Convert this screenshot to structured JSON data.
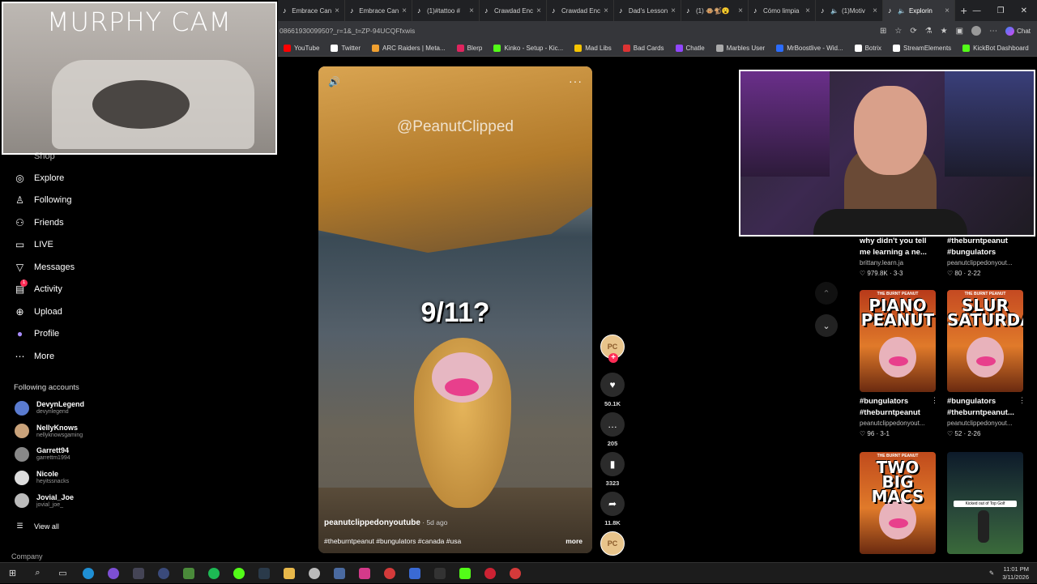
{
  "browser": {
    "tabs": [
      {
        "label": "Embrace Can"
      },
      {
        "label": "Embrace Can"
      },
      {
        "label": "(1)#tattoo #"
      },
      {
        "label": "Crawdad Enc"
      },
      {
        "label": "Crawdad Enc"
      },
      {
        "label": "Dad's Lesson"
      },
      {
        "label": "(1) 🐵🐒😮"
      },
      {
        "label": "Cómo limpia"
      },
      {
        "label": "(1)Motiv"
      },
      {
        "label": "Explorin"
      }
    ],
    "url": "0866193009950?_r=1&_t=ZP-94UCQFfxwis",
    "chat_label": "Chat",
    "bookmarks": [
      {
        "label": "YouTube",
        "color": "#ff0000"
      },
      {
        "label": "Twitter",
        "color": "#ffffff"
      },
      {
        "label": "ARC Raiders | Meta...",
        "color": "#f0a030"
      },
      {
        "label": "Blerp",
        "color": "#e0245e"
      },
      {
        "label": "Kinko - Setup - Kic...",
        "color": "#53fc18"
      },
      {
        "label": "Mad Libs",
        "color": "#f5c400"
      },
      {
        "label": "Bad Cards",
        "color": "#d33"
      },
      {
        "label": "Chatle",
        "color": "#9146ff"
      },
      {
        "label": "Marbles User",
        "color": "#aaaaaa"
      },
      {
        "label": "MrBoostlive - Wid...",
        "color": "#2b6cff"
      },
      {
        "label": "Botrix",
        "color": "#ffffff"
      },
      {
        "label": "StreamElements",
        "color": "#ffffff"
      },
      {
        "label": "KickBot Dashboard",
        "color": "#53fc18"
      }
    ]
  },
  "overlay": {
    "murphy_title": "MURPHY CAM"
  },
  "sidebar": {
    "shop_label": "Shop",
    "items": [
      {
        "label": "Explore",
        "icon": "compass-icon"
      },
      {
        "label": "Following",
        "icon": "following-icon"
      },
      {
        "label": "Friends",
        "icon": "friends-icon"
      },
      {
        "label": "LIVE",
        "icon": "live-icon"
      },
      {
        "label": "Messages",
        "icon": "messages-icon"
      },
      {
        "label": "Activity",
        "icon": "activity-icon",
        "badge": "1"
      },
      {
        "label": "Upload",
        "icon": "upload-icon"
      },
      {
        "label": "Profile",
        "icon": "profile-icon"
      },
      {
        "label": "More",
        "icon": "more-icon"
      }
    ],
    "following_accounts_label": "Following accounts",
    "accounts": [
      {
        "name": "DevynLegend",
        "handle": "devynlegend",
        "color": "#5a7bd0"
      },
      {
        "name": "NellyKnows",
        "handle": "nellyknowsgaming",
        "color": "#c9a27a"
      },
      {
        "name": "Garrett94",
        "handle": "garrettm1994",
        "color": "#888888"
      },
      {
        "name": "Nicole",
        "handle": "heyitssnacks",
        "color": "#dddddd"
      },
      {
        "name": "Jovial_Joe",
        "handle": "jovial_joe_",
        "color": "#bbbbbb"
      }
    ],
    "view_all_label": "View all",
    "company_label": "Company"
  },
  "video": {
    "watermark": "@PeanutClipped",
    "caption": "9/11?",
    "author": "peanutclippedonyoutube",
    "posted": " · 5d ago",
    "tags": "#theburntpeanut #bungulators #canada #usa",
    "more_label": "more",
    "avatar_text": "PC"
  },
  "actions": {
    "likes": "50.1K",
    "comments": "205",
    "saves": "3323",
    "shares": "11.8K"
  },
  "right_column": {
    "top": [
      {
        "title1": "why didn't you tell",
        "title2": "me learning a ne...",
        "user": "brittany.learn.ja",
        "meta": "♡ 979.8K · 3-3"
      },
      {
        "title1": "#theburntpeanut",
        "title2": "#bungulators",
        "user": "peanutclippedonyout...",
        "meta": "♡ 80 · 2-22"
      }
    ],
    "cards": [
      {
        "thumb_text": "PIANO PEANUT",
        "thumb_sup": "THE BURNT PEANUT",
        "bg": "#b83a1a",
        "title1": "#bungulators",
        "title2": "#theburntpeanut",
        "user": "peanutclippedonyout...",
        "meta": "♡ 96 · 3-1"
      },
      {
        "thumb_text": "SLUR SATURDAY",
        "thumb_sup": "THE BURNT PEANUT",
        "bg": "#c54a22",
        "title1": "#bungulators",
        "title2": "#theburntpeanut...",
        "user": "peanutclippedonyout...",
        "meta": "♡ 52 · 2-26"
      },
      {
        "thumb_text": "TWO BIG MACS",
        "thumb_sup": "THE BURNT PEANUT",
        "bg": "#c04a1c",
        "title1": "",
        "title2": "",
        "user": "",
        "meta": ""
      },
      {
        "thumb_text": "Kicked out of Top Golf",
        "thumb_sup": "",
        "bg": "#1a3a2a",
        "title1": "",
        "title2": "",
        "user": "",
        "meta": ""
      }
    ]
  },
  "taskbar": {
    "time": "11:01 PM",
    "date": "3/11/2026"
  }
}
